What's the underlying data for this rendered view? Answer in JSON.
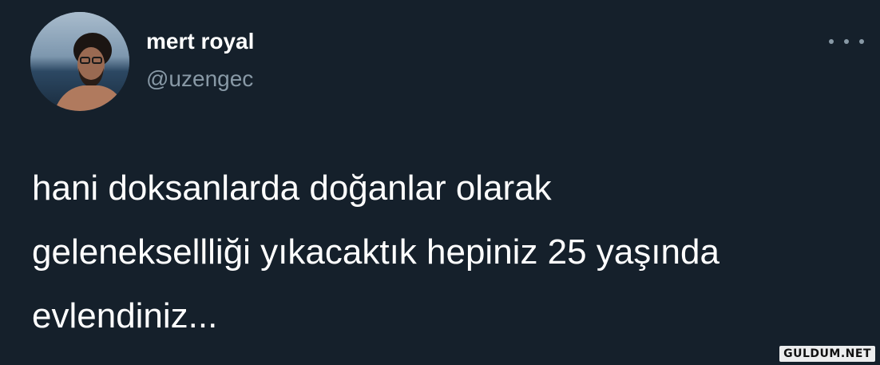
{
  "user": {
    "display_name": "mert royal",
    "handle": "@uzengec",
    "avatar_icon": "profile-photo"
  },
  "more_icon": "more-horizontal-icon",
  "tweet": {
    "lines": [
      "hani doksanlarda doğanlar olarak",
      "geleneksellliği yıkacaktık hepiniz 25 yaşında",
      "evlendiniz..."
    ]
  },
  "watermark": {
    "text": "GULDUM.NET"
  },
  "colors": {
    "background": "#15202b",
    "primary_text": "#ffffff",
    "secondary_text": "#8899a6"
  }
}
